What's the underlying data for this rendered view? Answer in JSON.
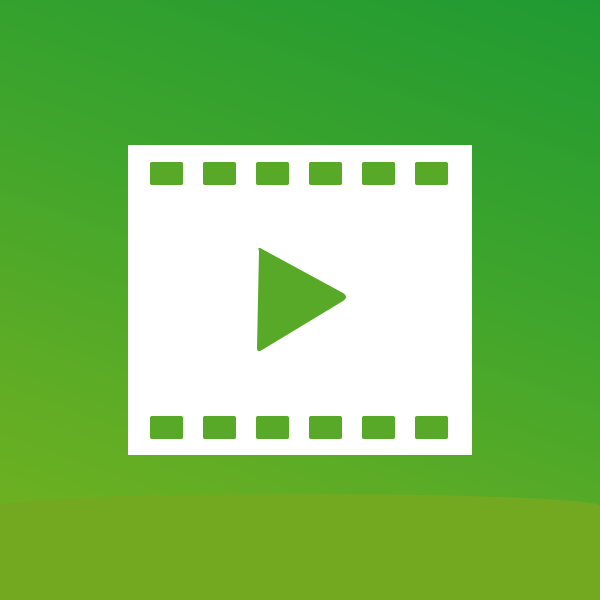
{
  "icon": {
    "name": "video-play-icon",
    "colors": {
      "background_top": "#1f9a32",
      "background_bottom": "#74b41e",
      "band": "#73a920",
      "film": "#ffffff",
      "accent": "#59a928"
    },
    "perforations_per_row": 6
  }
}
